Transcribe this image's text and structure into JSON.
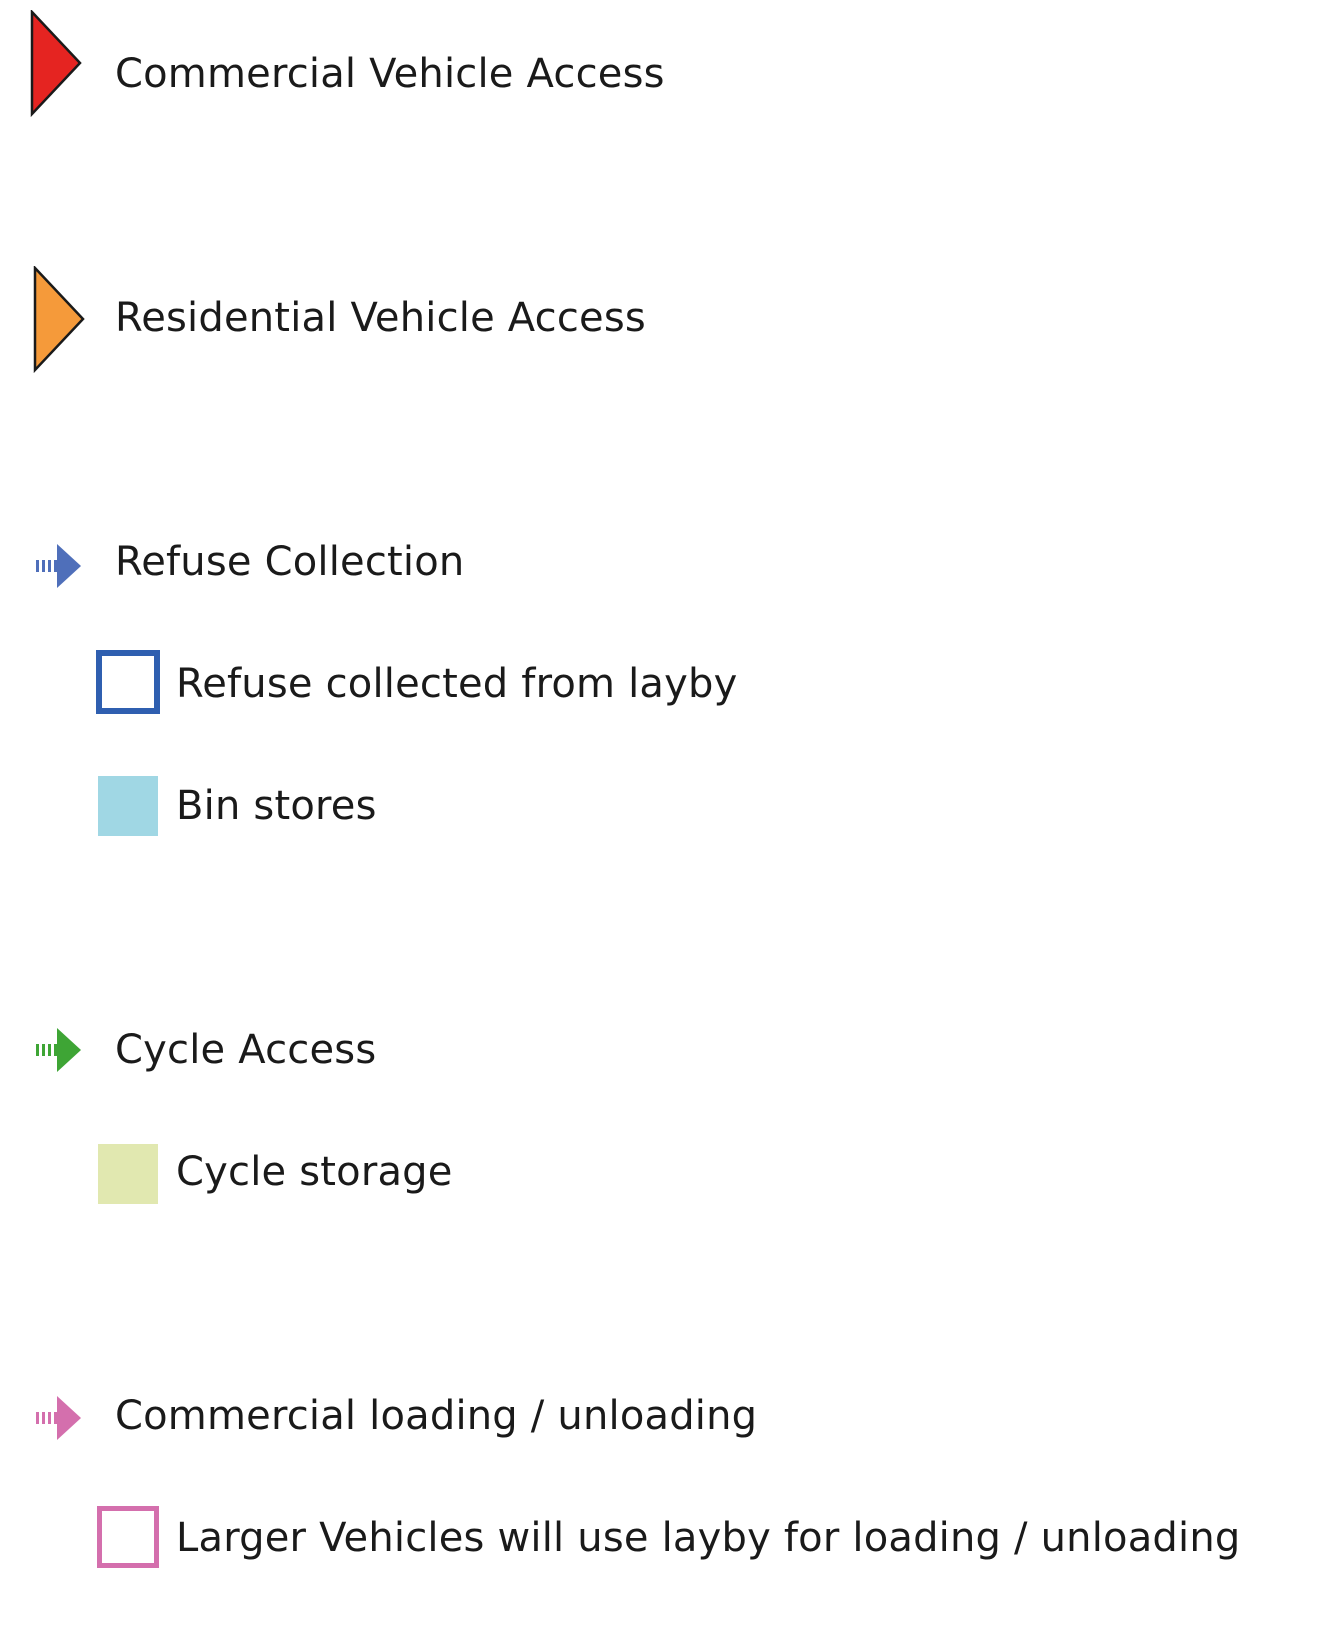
{
  "legend": {
    "commercial_vehicle": {
      "label": "Commercial Vehicle Access",
      "icon": "solid-triangle-arrow-icon",
      "color": "#e52421"
    },
    "residential_vehicle": {
      "label": "Residential Vehicle Access",
      "icon": "solid-triangle-arrow-icon",
      "color": "#f59a3a"
    },
    "refuse_collection": {
      "label": "Refuse Collection",
      "icon": "dashed-arrow-icon",
      "color": "#4f6fba",
      "items": [
        {
          "label": "Refuse collected from layby",
          "icon": "outline-square-icon",
          "color": "#2f5fb0"
        },
        {
          "label": "Bin stores",
          "icon": "filled-square-icon",
          "color": "#a0d7e4"
        }
      ]
    },
    "cycle_access": {
      "label": "Cycle Access",
      "icon": "dashed-arrow-icon",
      "color": "#3ea535",
      "items": [
        {
          "label": "Cycle storage",
          "icon": "filled-square-icon",
          "color": "#e1e8b0"
        }
      ]
    },
    "commercial_loading": {
      "label": "Commercial loading / unloading",
      "icon": "dashed-arrow-icon",
      "color": "#d46fad",
      "items": [
        {
          "label": "Larger Vehicles will use layby for loading / unloading",
          "icon": "outline-square-icon",
          "color": "#d46fad"
        }
      ]
    }
  }
}
